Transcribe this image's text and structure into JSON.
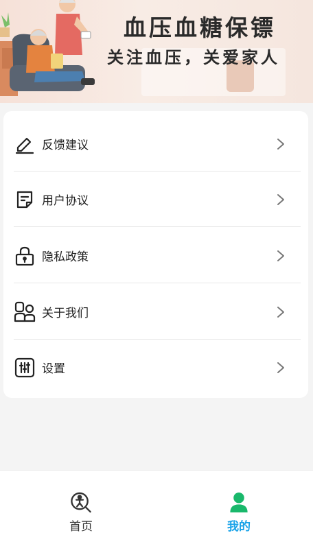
{
  "banner": {
    "title": "血压血糖保镖",
    "subtitle": "关注血压，关爱家人"
  },
  "menu": {
    "items": [
      {
        "label": "反馈建议",
        "icon": "edit-pen-icon"
      },
      {
        "label": "用户协议",
        "icon": "document-icon"
      },
      {
        "label": "隐私政策",
        "icon": "lock-icon"
      },
      {
        "label": "关于我们",
        "icon": "people-icon"
      },
      {
        "label": "设置",
        "icon": "settings-sliders-icon"
      }
    ],
    "chevron_icon": "chevron-right-icon"
  },
  "tabbar": {
    "tabs": [
      {
        "label": "首页",
        "icon": "home-search-icon",
        "active": false
      },
      {
        "label": "我的",
        "icon": "user-icon",
        "active": true
      }
    ],
    "active_color": "#1aa3e8",
    "active_icon_color": "#19b86b"
  }
}
